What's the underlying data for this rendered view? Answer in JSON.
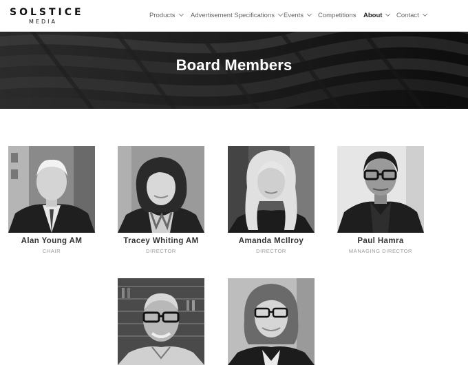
{
  "logo": {
    "line1": "SOLSTICE",
    "line2": "MEDIA"
  },
  "nav": {
    "items": [
      {
        "label": "Products",
        "dropdown": true,
        "active": false
      },
      {
        "label": "Advertisement Specifications",
        "dropdown": true,
        "active": false
      },
      {
        "label": "Events",
        "dropdown": true,
        "active": false
      },
      {
        "label": "Competitions",
        "dropdown": false,
        "active": false
      },
      {
        "label": "About",
        "dropdown": true,
        "active": true
      },
      {
        "label": "Contact",
        "dropdown": true,
        "active": false
      }
    ]
  },
  "banner": {
    "title": "Board Members"
  },
  "members": [
    {
      "name": "Alan Young AM",
      "role": "CHAIR"
    },
    {
      "name": "Tracey Whiting AM",
      "role": "DIRECTOR"
    },
    {
      "name": "Amanda McIlroy",
      "role": "DIRECTOR"
    },
    {
      "name": "Paul Hamra",
      "role": "MANAGING DIRECTOR"
    },
    {
      "name": "",
      "role": ""
    },
    {
      "name": "",
      "role": ""
    }
  ]
}
